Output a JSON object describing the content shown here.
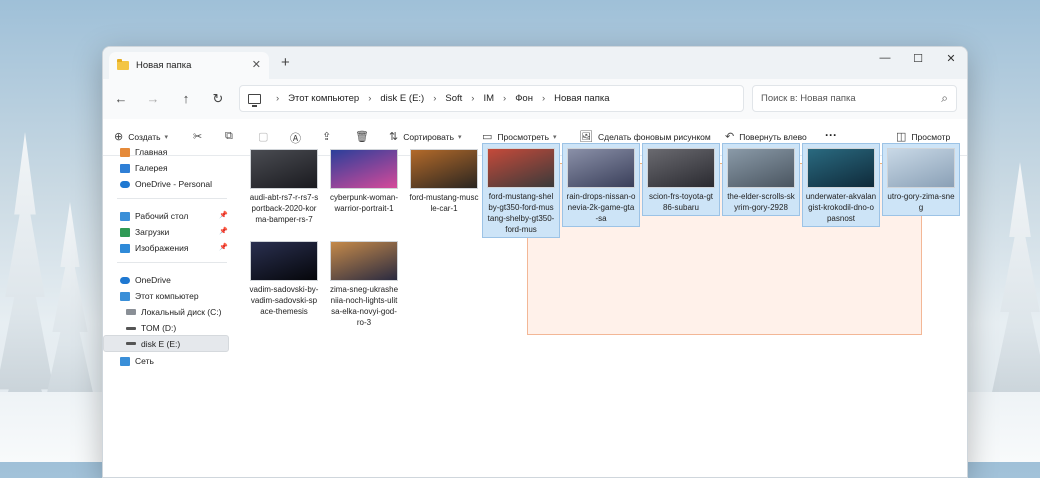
{
  "window": {
    "tab_title": "Новая папка",
    "tab_close": "✕",
    "new_tab": "+",
    "controls": {
      "minimize": "—",
      "maximize": "☐",
      "close": "✕"
    }
  },
  "nav": {
    "back": "←",
    "forward": "→",
    "up": "↑",
    "refresh": "↻",
    "breadcrumbs": [
      "Этот компьютер",
      "disk E (E:)",
      "Soft",
      "IM",
      "Фон",
      "Новая папка"
    ],
    "search_placeholder": "Поиск в: Новая папка",
    "search_icon": "⌕"
  },
  "toolbar": {
    "create": "Создать",
    "sort": "Сортировать",
    "view": "Просмотреть",
    "set_wallpaper": "Сделать фоновым рисунком",
    "rotate_left": "Повернуть влево",
    "more": "···",
    "preview": "Просмотр"
  },
  "sidebar": {
    "group1": [
      {
        "label": "Главная",
        "icon": "home-icon",
        "color": "#e58a3a"
      },
      {
        "label": "Галерея",
        "icon": "gallery-icon",
        "color": "#2f7fd6"
      },
      {
        "label": "OneDrive - Personal",
        "icon": "cloud-icon",
        "color": "#1f78d1"
      }
    ],
    "group2": [
      {
        "label": "Рабочий стол",
        "icon": "desktop-icon",
        "color": "#3a8fd8"
      },
      {
        "label": "Загрузки",
        "icon": "download-icon",
        "color": "#2f9a55"
      },
      {
        "label": "Изображения",
        "icon": "pictures-icon",
        "color": "#2f8ad8"
      }
    ],
    "group3": [
      {
        "label": "OneDrive",
        "icon": "cloud-icon",
        "color": "#1f78d1"
      },
      {
        "label": "Этот компьютер",
        "icon": "computer-icon",
        "color": "#3a8fd8"
      },
      {
        "label": "Локальный диск (C:)",
        "icon": "drive-c-icon",
        "color": "#666666"
      },
      {
        "label": "TOM (D:)",
        "icon": "drive-icon",
        "color": "#555555"
      },
      {
        "label": "disk E (E:)",
        "icon": "drive-icon",
        "color": "#555555"
      },
      {
        "label": "Сеть",
        "icon": "network-icon",
        "color": "#3a8fd8"
      }
    ]
  },
  "files": [
    {
      "name": "audi-abt-rs7-r-rs7-sportback-2020-korma-bamper-rs-7",
      "lines": [
        "audi-abt-rs7-r-rs7-s",
        "portback-2020-kor",
        "ma-bamper-rs-7"
      ],
      "colors": [
        "#4a4c52",
        "#1a1a1f"
      ],
      "selected": false
    },
    {
      "name": "cyberpunk-woman-warrior-portrait-1",
      "lines": [
        "cyberpunk-woman-",
        "warrior-portrait-1"
      ],
      "colors": [
        "#2a3f9a",
        "#d64a9a"
      ],
      "selected": false
    },
    {
      "name": "ford-mustang-muscle-car-1",
      "lines": [
        "ford-mustang-musc",
        "le-car-1"
      ],
      "colors": [
        "#b36a2a",
        "#2a2520"
      ],
      "selected": false
    },
    {
      "name": "ford-mustang-shelby-gt350-ford-mustang-shelby-gt350-ford-mus",
      "lines": [
        "ford-mustang-shel",
        "by-gt350-ford-mus",
        "tang-shelby-gt350-",
        "ford-mus"
      ],
      "colors": [
        "#c54a3a",
        "#3a3a3a"
      ],
      "selected": true
    },
    {
      "name": "rain-drops-nissan-onevia-2k-game-gta-sa",
      "lines": [
        "rain-drops-nissan-o",
        "nevia-2k-game-gta",
        "-sa"
      ],
      "colors": [
        "#8a90a8",
        "#3a3f5a"
      ],
      "selected": true
    },
    {
      "name": "scion-frs-toyota-gt86-subaru",
      "lines": [
        "scion-frs-toyota-gt",
        "86-subaru"
      ],
      "colors": [
        "#6a6a70",
        "#2a2a30"
      ],
      "selected": true
    },
    {
      "name": "the-elder-scrolls-skyrim-gory-2928",
      "lines": [
        "the-elder-scrolls-sk",
        "yrim-gory-2928"
      ],
      "colors": [
        "#8a9aa8",
        "#4a5560"
      ],
      "selected": true
    },
    {
      "name": "underwater-akvalangist-krokodil-dno-opasnost",
      "lines": [
        "underwater-akvalan",
        "gist-krokodil-dno-o",
        "pasnost"
      ],
      "colors": [
        "#2a6a80",
        "#0f2a3a"
      ],
      "selected": true
    },
    {
      "name": "utro-gory-zima-sneg",
      "lines": [
        "utro-gory-zima-sne",
        "g"
      ],
      "colors": [
        "#c8d8e6",
        "#8aa0b6"
      ],
      "selected": true
    },
    {
      "name": "vadim-sadovski-by-vadim-sadovski-space-themesis",
      "lines": [
        "vadim-sadovski-by-",
        "vadim-sadovski-sp",
        "ace-themesis"
      ],
      "colors": [
        "#2a3050",
        "#05060a"
      ],
      "selected": false
    },
    {
      "name": "zima-sneg-ukrasheniia-noch-lights-ulitsa-elka-novyi-god-ro-3",
      "lines": [
        "zima-sneg-ukrashe",
        "niia-noch-lights-ulit",
        "sa-elka-novyi-god-",
        "ro-3"
      ],
      "colors": [
        "#c58a4a",
        "#2a2a40"
      ],
      "selected": false
    }
  ]
}
